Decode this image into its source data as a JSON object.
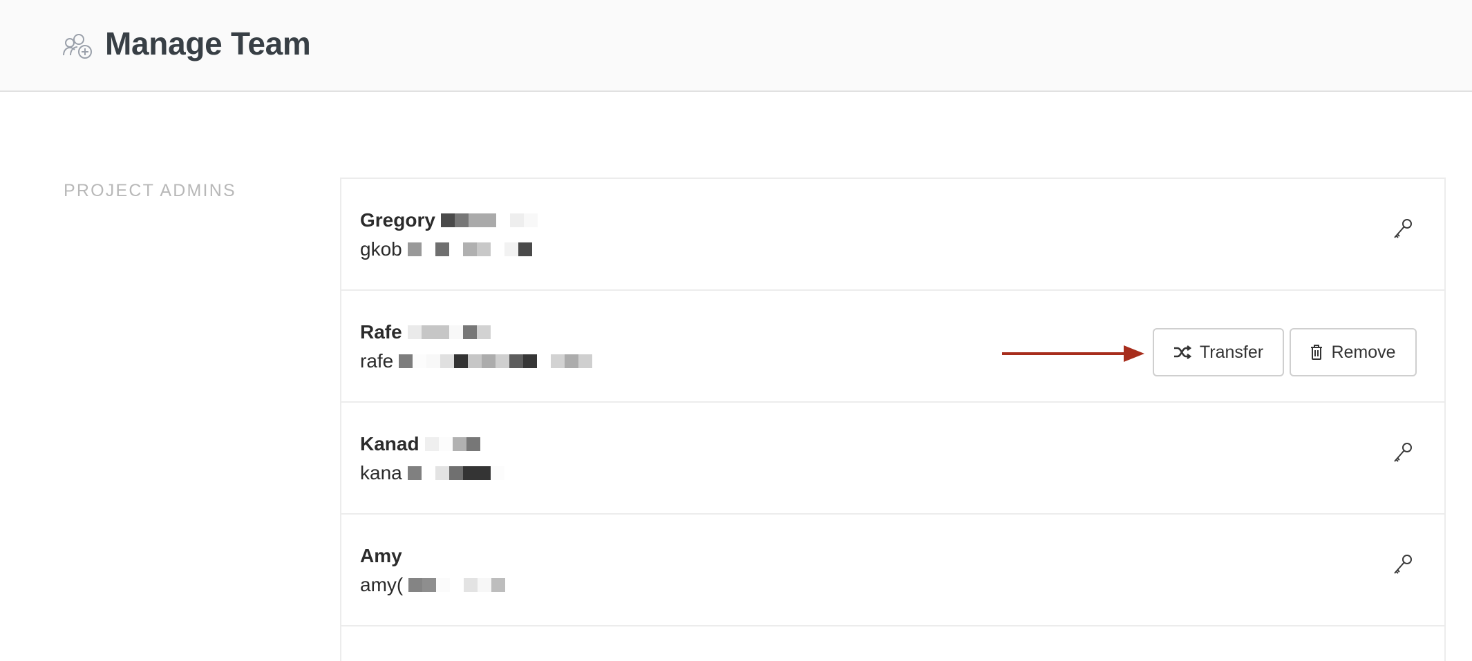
{
  "header": {
    "title": "Manage Team",
    "icon": "team-add-icon"
  },
  "section": {
    "label": "PROJECT ADMINS"
  },
  "members": [
    {
      "name": "Gregory",
      "email": "gkob",
      "action": "key-icon",
      "name_redact": [
        "#4a4a4a",
        "#777",
        "#aaa",
        "#aaa",
        "#fff",
        "#eee",
        "#f8f8f8"
      ],
      "email_redact": [
        "#999",
        "#fff",
        "#6f6f6f",
        "#fff",
        "#b0b0b0",
        "#c8c8c8",
        "#fff",
        "#f2f2f2",
        "#4a4a4a"
      ]
    },
    {
      "name": "Rafe",
      "email": "rafe",
      "action": "buttons",
      "name_redact": [
        "#eaeaea",
        "#c6c6c6",
        "#c6c6c6",
        "#f8f8f8",
        "#777",
        "#d2d2d2"
      ],
      "email_redact": [
        "#7d7d7d",
        "#fcfcfc",
        "#f8f8f8",
        "#e0e0e0",
        "#333",
        "#c6c6c6",
        "#acacac",
        "#cfcfcf",
        "#5d5d5d",
        "#363636",
        "#fff",
        "#d2d2d2",
        "#acacac",
        "#cfcfcf"
      ]
    },
    {
      "name": "Kanad",
      "email": "kana",
      "action": "key-icon",
      "name_redact": [
        "#efefef",
        "#fcfcfc",
        "#b1b1b1",
        "#777"
      ],
      "email_redact": [
        "#808080",
        "#fff",
        "#e3e3e3",
        "#707070",
        "#343434",
        "#343434",
        "#fcfcfc"
      ]
    },
    {
      "name": "Amy",
      "email": "amy(",
      "action": "key-icon",
      "name_redact": [],
      "email_redact": [
        "#848484",
        "#8e8e8e",
        "#fbfbfb",
        "#fff",
        "#e3e3e3",
        "#f7f7f7",
        "#bdbdbd"
      ]
    }
  ],
  "buttons": {
    "transfer_label": "Transfer",
    "remove_label": "Remove"
  },
  "annotation": {
    "arrow_color": "#a72d1c"
  }
}
